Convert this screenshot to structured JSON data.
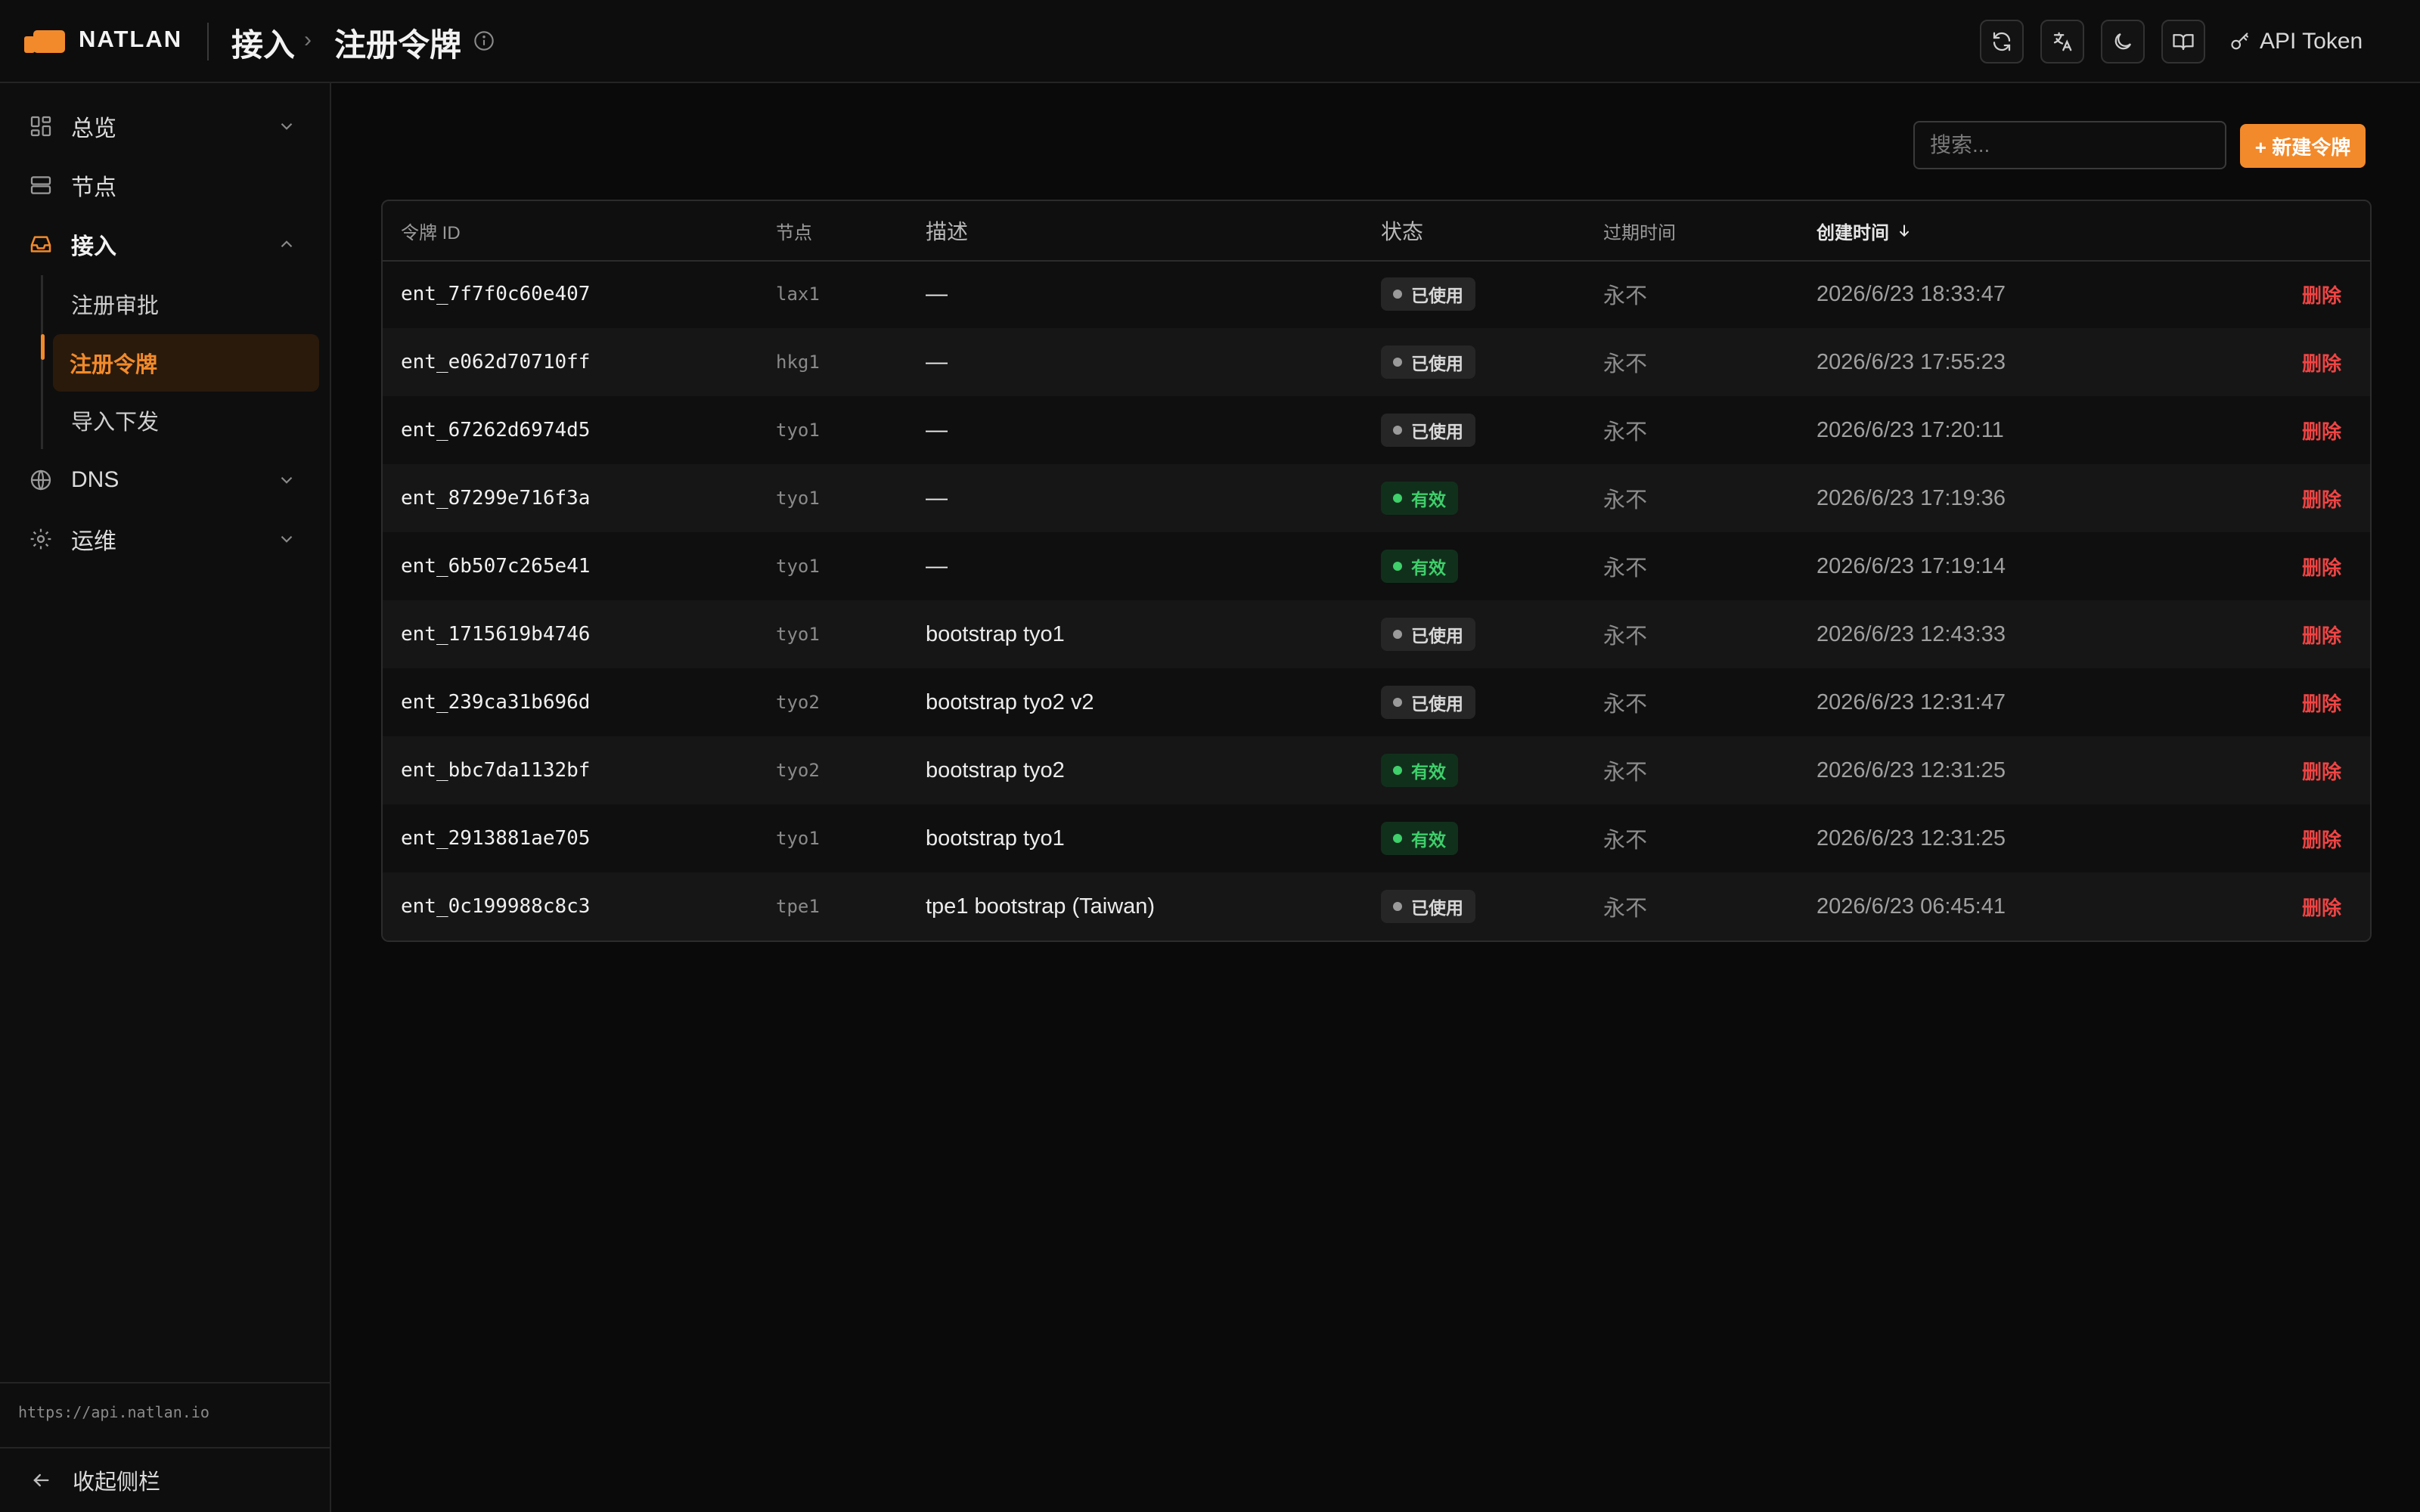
{
  "brand": "NATLAN",
  "breadcrumb": {
    "parent": "接入",
    "separator": "›",
    "current": "注册令牌"
  },
  "header": {
    "api_token_label": "API Token"
  },
  "sidebar": {
    "items": [
      {
        "label": "总览"
      },
      {
        "label": "节点"
      },
      {
        "label": "接入",
        "children": [
          "注册审批",
          "注册令牌",
          "导入下发"
        ]
      },
      {
        "label": "DNS"
      },
      {
        "label": "运维"
      }
    ],
    "api_url": "https://api.natlan.io",
    "collapse_label": "收起侧栏"
  },
  "toolbar": {
    "search_placeholder": "搜索...",
    "new_button": "+ 新建令牌"
  },
  "table": {
    "columns": [
      "令牌 ID",
      "节点",
      "描述",
      "状态",
      "过期时间",
      "创建时间"
    ],
    "rows": [
      {
        "id": "ent_7f7f0c60e407",
        "node": "lax1",
        "desc": "—",
        "status": "已使用",
        "expires": "永不",
        "created": "2026/6/23 18:33:47",
        "action": "删除"
      },
      {
        "id": "ent_e062d70710ff",
        "node": "hkg1",
        "desc": "—",
        "status": "已使用",
        "expires": "永不",
        "created": "2026/6/23 17:55:23",
        "action": "删除"
      },
      {
        "id": "ent_67262d6974d5",
        "node": "tyo1",
        "desc": "—",
        "status": "已使用",
        "expires": "永不",
        "created": "2026/6/23 17:20:11",
        "action": "删除"
      },
      {
        "id": "ent_87299e716f3a",
        "node": "tyo1",
        "desc": "—",
        "status": "有效",
        "expires": "永不",
        "created": "2026/6/23 17:19:36",
        "action": "删除"
      },
      {
        "id": "ent_6b507c265e41",
        "node": "tyo1",
        "desc": "—",
        "status": "有效",
        "expires": "永不",
        "created": "2026/6/23 17:19:14",
        "action": "删除"
      },
      {
        "id": "ent_1715619b4746",
        "node": "tyo1",
        "desc": "bootstrap tyo1",
        "status": "已使用",
        "expires": "永不",
        "created": "2026/6/23 12:43:33",
        "action": "删除"
      },
      {
        "id": "ent_239ca31b696d",
        "node": "tyo2",
        "desc": "bootstrap tyo2 v2",
        "status": "已使用",
        "expires": "永不",
        "created": "2026/6/23 12:31:47",
        "action": "删除"
      },
      {
        "id": "ent_bbc7da1132bf",
        "node": "tyo2",
        "desc": "bootstrap tyo2",
        "status": "有效",
        "expires": "永不",
        "created": "2026/6/23 12:31:25",
        "action": "删除"
      },
      {
        "id": "ent_2913881ae705",
        "node": "tyo1",
        "desc": "bootstrap tyo1",
        "status": "有效",
        "expires": "永不",
        "created": "2026/6/23 12:31:25",
        "action": "删除"
      },
      {
        "id": "ent_0c199988c8c3",
        "node": "tpe1",
        "desc": "tpe1 bootstrap (Taiwan)",
        "status": "已使用",
        "expires": "永不",
        "created": "2026/6/23 06:45:41",
        "action": "删除"
      }
    ]
  },
  "colors": {
    "accent": "#f28a2b",
    "danger": "#ef4444",
    "valid": "#3fcf6b",
    "background": "#0a0a0a"
  }
}
